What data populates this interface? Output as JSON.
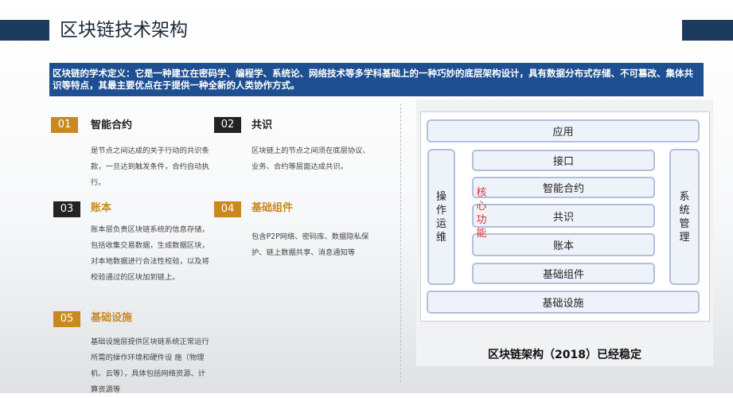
{
  "header": {
    "title": "区块链技术架构"
  },
  "definition": "区块链的学术定义：它是一种建立在密码学、编程学、系统论、网络技术等多学科基础上的一种巧妙的底层架构设计，具有数据分布式存储、不可篡改、集体共识等特点，其最主要优点在于提供一种全新的人类协作方式。",
  "items": [
    {
      "number": "01",
      "title": "智能合约",
      "desc": "是节点之间达成的关于行动的共识条款，一旦达到触发条件，合约自动执行。"
    },
    {
      "number": "02",
      "title": "共识",
      "desc": "区块链上的节点之间须在底层协议、业务、合约等层面达成共识。"
    },
    {
      "number": "03",
      "title": "账本",
      "desc": "账本层负责区块链系统的信息存储，包括收集交易数据，生成数据区块，对本地数据进行合法性校验，以及将校验通过的区块加到链上。"
    },
    {
      "number": "04",
      "title": "基础组件",
      "desc": "包含P2P网络、密码库、数据隐私保护、链上数据共享、消息通知等"
    },
    {
      "number": "05",
      "title": "基础设施",
      "desc": "基础设施层提供区块链系统正常运行所需的操作环境和硬件设 施（物理机、云等），具体包括网络资源、计算资源等"
    }
  ],
  "diagram": {
    "top_layer": "应用",
    "core_layers": [
      "接口",
      "智能合约",
      "共识",
      "账本",
      "基础组件"
    ],
    "bottom_layer": "基础设施",
    "left_side": "操作运维",
    "right_side": "系统管理",
    "core_label": "核心功能",
    "caption": "区块链架构（2018）已经稳定",
    "colors": {
      "layer_fill": "#eef2f9",
      "layer_border": "#b3bfdc",
      "core_label": "#d23b3b"
    }
  },
  "colors": {
    "accent_navy": "#1b3a5e",
    "definition_bg": "#1d4f91",
    "gold": "#c98921",
    "dark": "#232323"
  }
}
